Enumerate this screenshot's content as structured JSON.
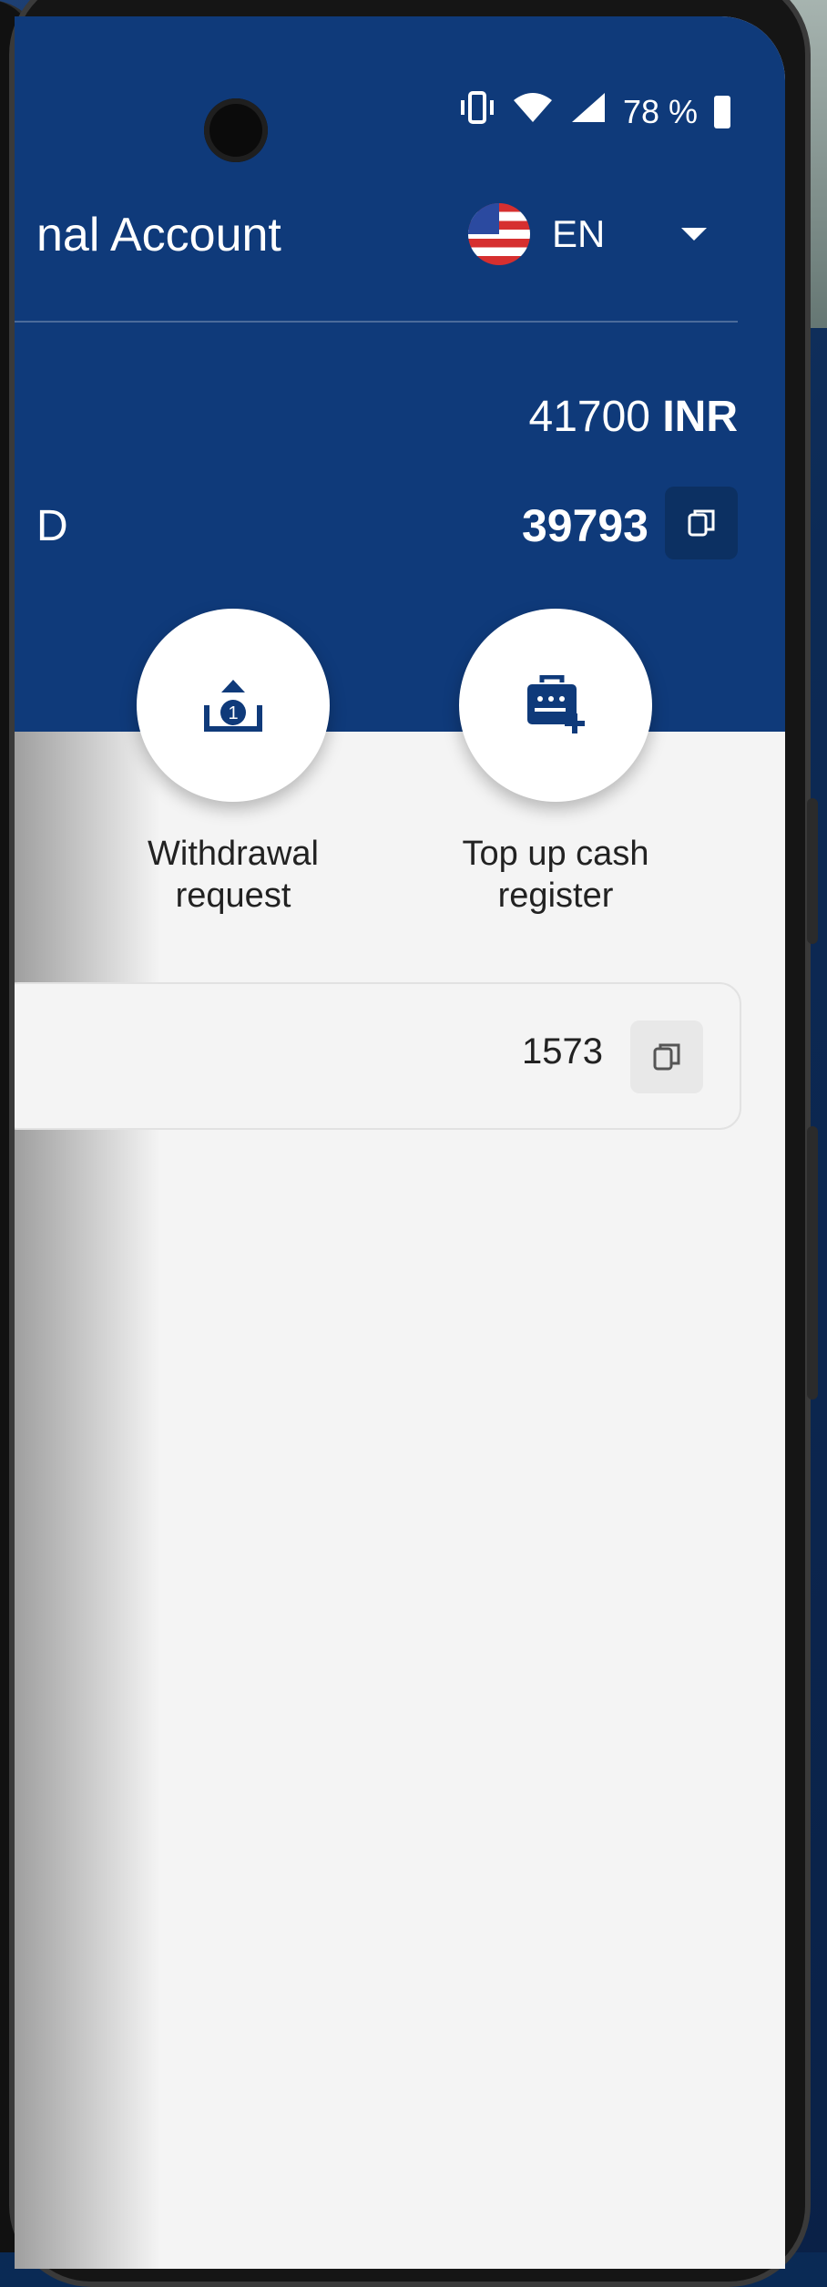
{
  "status_bar": {
    "battery": "78 %"
  },
  "header": {
    "title": "nal Account",
    "language": "EN",
    "balance_primary_value": "41700",
    "balance_primary_currency": "INR",
    "balance_secondary_label": "D",
    "balance_secondary_value": "39793"
  },
  "actions": [
    {
      "label": "Withdrawal request",
      "icon": "withdrawal-icon"
    },
    {
      "label": "Top up cash register",
      "icon": "cash-register-add-icon"
    }
  ],
  "card": {
    "value": "1573"
  },
  "colors": {
    "brand": "#0f3a7a",
    "background": "#f4f4f4"
  }
}
